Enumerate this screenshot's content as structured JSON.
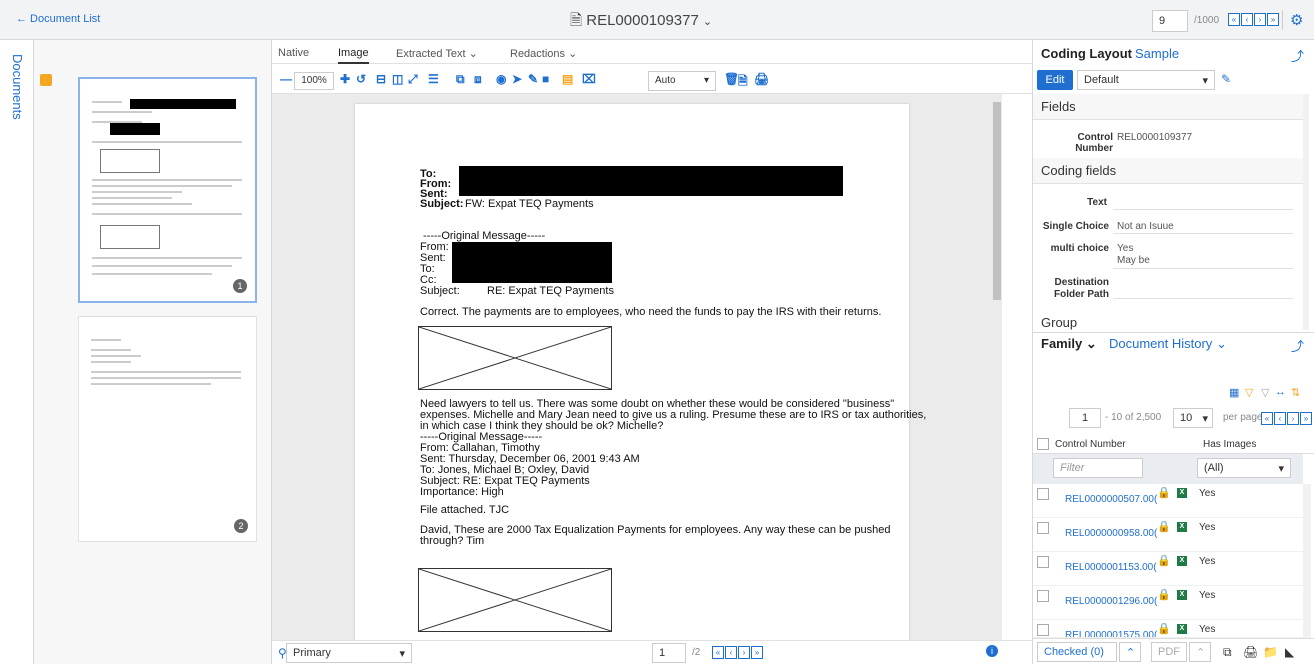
{
  "topbar": {
    "back_label": "← Document List",
    "doc_title": "REL0000109377",
    "page_input": "9",
    "page_total": "/1000"
  },
  "rail": {
    "label": "Documents"
  },
  "thumbnails": [
    {
      "page": "1"
    },
    {
      "page": "2"
    }
  ],
  "viewer_tabs": [
    {
      "label": "Native"
    },
    {
      "label": "Image"
    },
    {
      "label": "Extracted Text"
    },
    {
      "label": "Redactions"
    }
  ],
  "toolbar": {
    "zoom": "100%",
    "fit_mode": "Auto"
  },
  "page_text": {
    "to": "To:",
    "from": "From:",
    "sent": "Sent:",
    "subject_label": "Subject:",
    "subject": "FW: Expat TEQ Payments",
    "orig_msg": "-----Original Message-----",
    "from2": "From:",
    "sent2": "Sent:",
    "to2": "To:",
    "cc2": "Cc:",
    "subject2_label": "Subject:",
    "subject2": "RE: Expat TEQ Payments",
    "para1": "Correct.  The payments are to employees, who need the funds to pay the IRS with their returns.",
    "para2_l1": "Need lawyers to tell us. There was some doubt on whether these would be considered \"business\"",
    "para2_l2": "expenses. Michelle and Mary Jean need to give us a ruling. Presume these are to IRS or tax authorities,",
    "para2_l3": "in which case I think they should be ok? Michelle?",
    "orig_msg2": " -----Original Message-----",
    "from3": "From:   Callahan, Timothy",
    "sent3": "Sent:    Thursday, December 06, 2001 9:43 AM",
    "to3": "To:       Jones, Michael B; Oxley, David",
    "subject3": "Subject:            RE: Expat TEQ Payments",
    "importance": "Importance:       High",
    "file_attached": "File attached.  TJC",
    "para3_l1": "David,  These are 2000 Tax Equalization Payments for employees.  Any way these can be pushed",
    "para3_l2": "through?  Tim"
  },
  "footer": {
    "layer": "Primary",
    "page": "1",
    "page_total": "/2"
  },
  "coding": {
    "tab_active": "Coding Layout",
    "tab_other": "Sample",
    "edit_label": "Edit",
    "layout_select": "Default",
    "fields_header": "Fields",
    "control_number_label": "Control Number",
    "control_number_value": "REL0000109377",
    "coding_header": "Coding fields",
    "text_label": "Text",
    "single_choice_label": "Single Choice",
    "single_choice_value": "Not an Isuue",
    "multi_choice_label": "multi choice",
    "multi_choice_value1": "Yes",
    "multi_choice_value2": "May be",
    "dest_label1": "Destination",
    "dest_label2": "Folder Path",
    "group_header": "Group"
  },
  "family": {
    "tab_active": "Family",
    "tab_other": "Document History",
    "page_input": "1",
    "range": "- 10 of 2,500",
    "per_page": "10",
    "per_page_label": "per page",
    "col_control": "Control Number",
    "col_images": "Has Images",
    "filter_placeholder": "Filter",
    "filter_all": "(All)",
    "rows": [
      {
        "control": "REL0000000507.00(",
        "images": "Yes"
      },
      {
        "control": "REL0000000958.00(",
        "images": "Yes"
      },
      {
        "control": "REL0000001153.00(",
        "images": "Yes"
      },
      {
        "control": "REL0000001296.00(",
        "images": "Yes"
      },
      {
        "control": "REL0000001575.00(",
        "images": "Yes"
      }
    ],
    "checked_label": "Checked (0)",
    "pdf_label": "PDF"
  }
}
